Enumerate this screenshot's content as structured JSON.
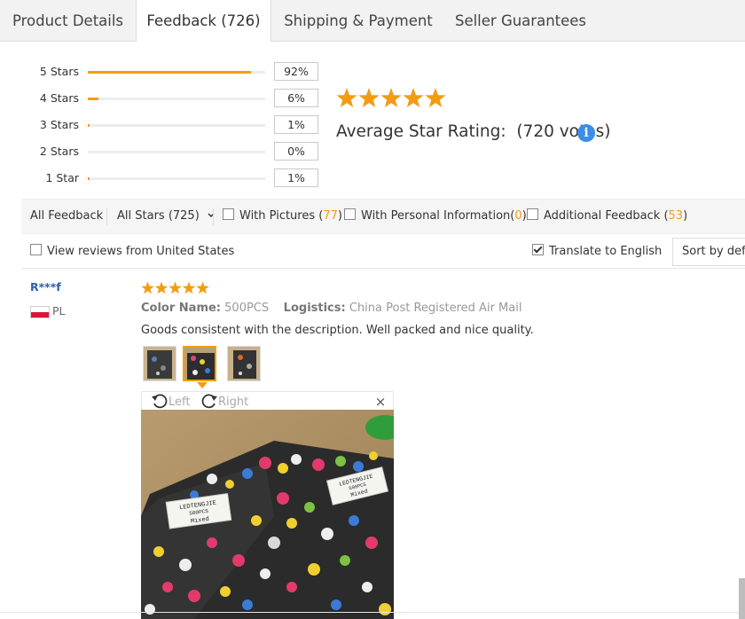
{
  "tabs": [
    {
      "label": "Product Details"
    },
    {
      "label": "Feedback (726)",
      "active": true
    },
    {
      "label": "Shipping & Payment"
    },
    {
      "label": "Seller Guarantees"
    }
  ],
  "histogram": [
    {
      "label": "5 Stars",
      "pct_text": "92%",
      "fill_fraction": 0.92
    },
    {
      "label": "4 Stars",
      "pct_text": "6%",
      "fill_fraction": 0.06
    },
    {
      "label": "3 Stars",
      "pct_text": "1%",
      "fill_fraction": 0.01
    },
    {
      "label": "2 Stars",
      "pct_text": "0%",
      "fill_fraction": 0.0
    },
    {
      "label": "1 Star",
      "pct_text": "1%",
      "fill_fraction": 0.01
    }
  ],
  "summary": {
    "stars": 5,
    "avg_label": "Average Star Rating:",
    "votes": "(720 votes)",
    "info_glyph": "i"
  },
  "filters": {
    "all_feedback": "All Feedback",
    "all_stars": "All Stars (725)",
    "with_pictures_label": "With Pictures",
    "with_pictures_open": " (",
    "with_pictures_count": "77",
    "with_pictures_close": ")",
    "personal_info_label": "With Personal Information",
    "personal_info_open": "(",
    "personal_info_count": "0",
    "personal_info_close": ")",
    "additional_label": "Additional Feedback",
    "additional_open": " (",
    "additional_count": "53",
    "additional_close": ")",
    "from_country": "View reviews from United States",
    "translate": "Translate to English",
    "translate_checked": true,
    "sort": "Sort by default"
  },
  "review": {
    "reviewer": "R***f",
    "country": "PL",
    "stars": 5,
    "color_label": "Color Name:",
    "color_value": "500PCS",
    "logistics_label": "Logistics:",
    "logistics_value": "China Post Registered Air Mail",
    "text": "Goods consistent with the description. Well packed and nice quality.",
    "rotate_left": "Left",
    "rotate_right": "Right",
    "close": "×",
    "photo_label_1": [
      "LEDTENGJIE",
      "500PCS",
      "Mixed"
    ],
    "photo_label_2": [
      "LEDTENGJIE",
      "500PCS",
      "Mixed"
    ]
  },
  "colors": {
    "accent": "#f39c12",
    "link": "#2a5fa8",
    "info": "#3a8ee6"
  }
}
